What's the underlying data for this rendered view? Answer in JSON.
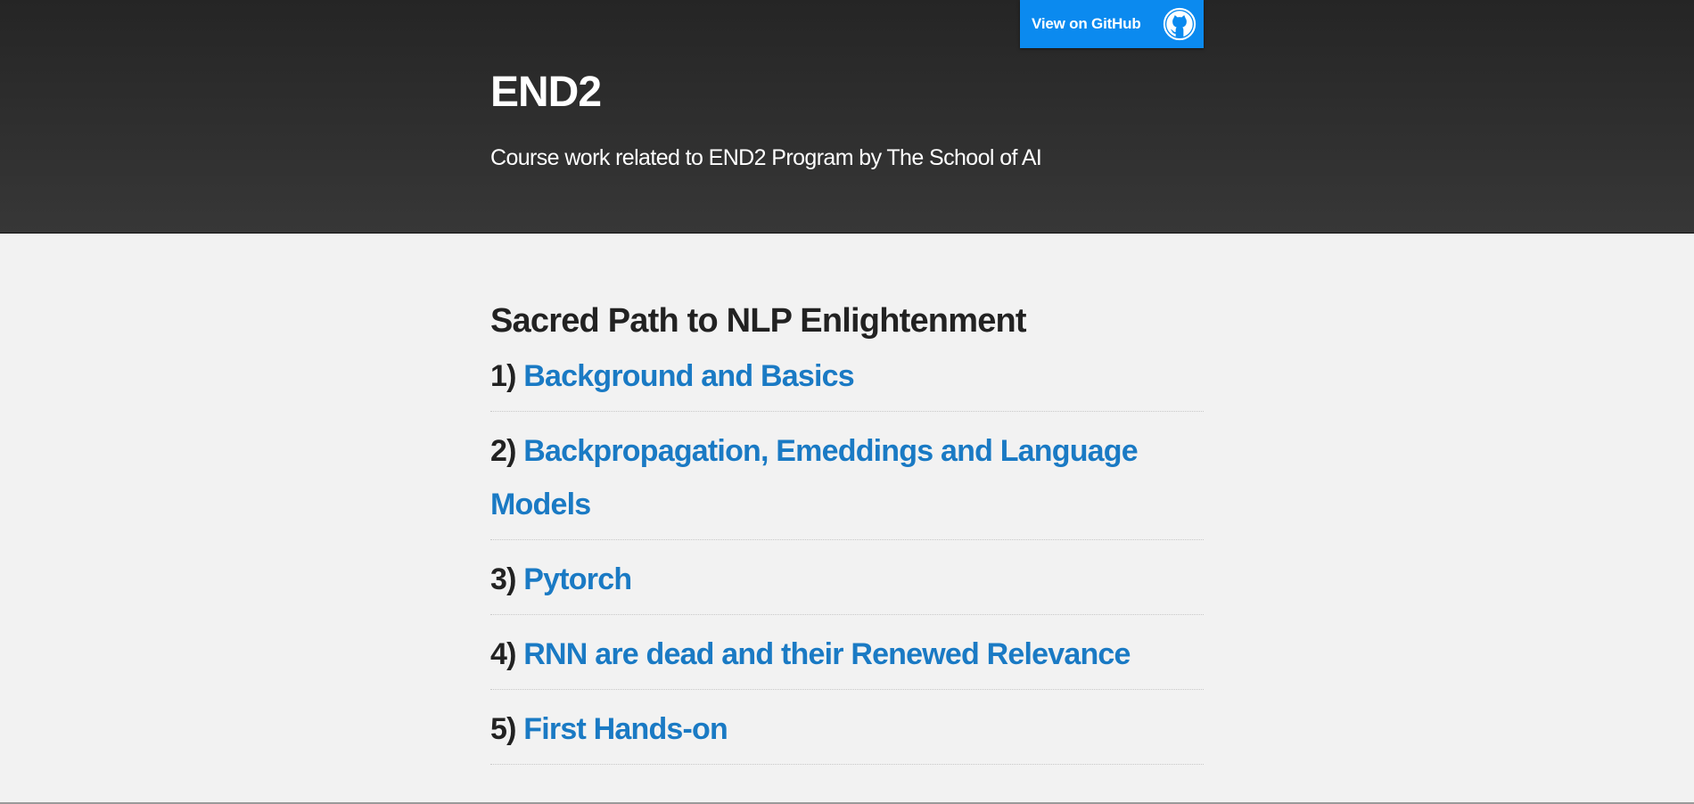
{
  "header": {
    "project_name": "END2",
    "tagline": "Course work related to END2 Program by The School of AI",
    "github_button": {
      "label": "View on GitHub",
      "icon": "github-octocat-icon"
    }
  },
  "main": {
    "section_title": "Sacred Path to NLP Enlightenment",
    "lessons": [
      {
        "number": "1)",
        "title": "Background and Basics"
      },
      {
        "number": "2)",
        "title": "Backpropagation, Emeddings and Language Models"
      },
      {
        "number": "3)",
        "title": "Pytorch"
      },
      {
        "number": "4)",
        "title": "RNN are dead and their Renewed Relevance"
      },
      {
        "number": "5)",
        "title": "First Hands-on"
      }
    ]
  },
  "colors": {
    "header_top": "#252525",
    "header_bottom": "#373737",
    "github_button": "#0b8aef",
    "link": "#1a7ac4",
    "page_background": "#f2f2f2",
    "text": "#222222"
  }
}
